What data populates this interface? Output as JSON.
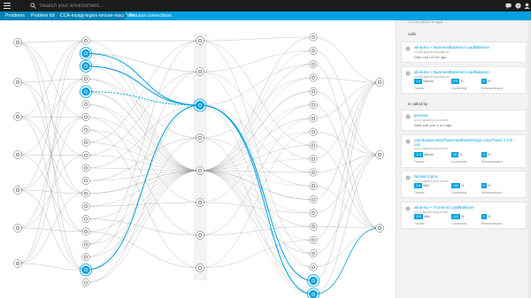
{
  "app": {
    "search_placeholder": "Search your environment...",
    "icons": [
      "menu-icon",
      "search-icon",
      "chat-icon",
      "help-icon",
      "user-icon"
    ]
  },
  "breadcrumbs": [
    {
      "label": "Problems"
    },
    {
      "label": "Problem 6ds"
    },
    {
      "label": "CCA-myapj-tegies-mnose-macathon"
    },
    {
      "label": "Process connections"
    }
  ],
  "colors": {
    "accent": "#00a1e0",
    "topbar": "#1b1b1b",
    "edge": "#9e9e9e",
    "panel": "#f2f2f2"
  },
  "panel": {
    "top_partial": "Y3 Sme (l/ll fol1 90 agol)",
    "calls_heading": "calls",
    "called_by_heading": "is called by",
    "calls": [
      {
        "name": "all-demo + BusinessBackend LoadBalancer",
        "sub": "on 464-apache-simulator.cs",
        "text": "Dark call 14 min ago"
      },
      {
        "name": "all-demo + BusinessBackend LoadBalancer",
        "sub": "on 464-apache-simulator.cs",
        "metrics": [
          {
            "value": "1.6",
            "unit": "MB/min",
            "label": "Transfer"
          },
          {
            "value": "0%",
            "unit": "%",
            "label": "Connectivity"
          },
          {
            "value": "0",
            "unit": "%",
            "label": "Retransmissions"
          }
        ]
      }
    ],
    "called_by": [
      {
        "name": "process",
        "sub": "on L/L apache-proy-current",
        "text": "Dark call over 1.4 h ago"
      },
      {
        "name": "cart-dunlap-easyTravel-webbackend.jar easyTravel 1.9.9 - cdc",
        "sub": "on L/L apache-proy-current",
        "metrics": [
          {
            "value": "174",
            "unit": "kB/min",
            "label": "Transfer"
          },
          {
            "value": "98",
            "unit": "%",
            "label": "Connectivity"
          },
          {
            "value": "0",
            "unit": "%",
            "label": "Retransmissions"
          }
        ]
      },
      {
        "name": "Nucast-3.proc",
        "sub": "on L/L apache-proy-current",
        "metrics": [
          {
            "value": "3.6",
            "unit": "kB/s",
            "label": "Transfer"
          },
          {
            "value": "100",
            "unit": "%",
            "label": "Connectivity"
          },
          {
            "value": "0",
            "unit": "%",
            "label": "Retransmissions"
          }
        ]
      },
      {
        "name": "all-demo + Frontend LoadBalancer",
        "sub": "on L/L apache-proy-current",
        "metrics": [
          {
            "value": "323",
            "unit": "kB/s",
            "label": "Transfer"
          },
          {
            "value": "100",
            "unit": "%",
            "label": "Connectivity"
          },
          {
            "value": "0",
            "unit": "%",
            "label": "Retransmissions"
          }
        ]
      }
    ]
  }
}
